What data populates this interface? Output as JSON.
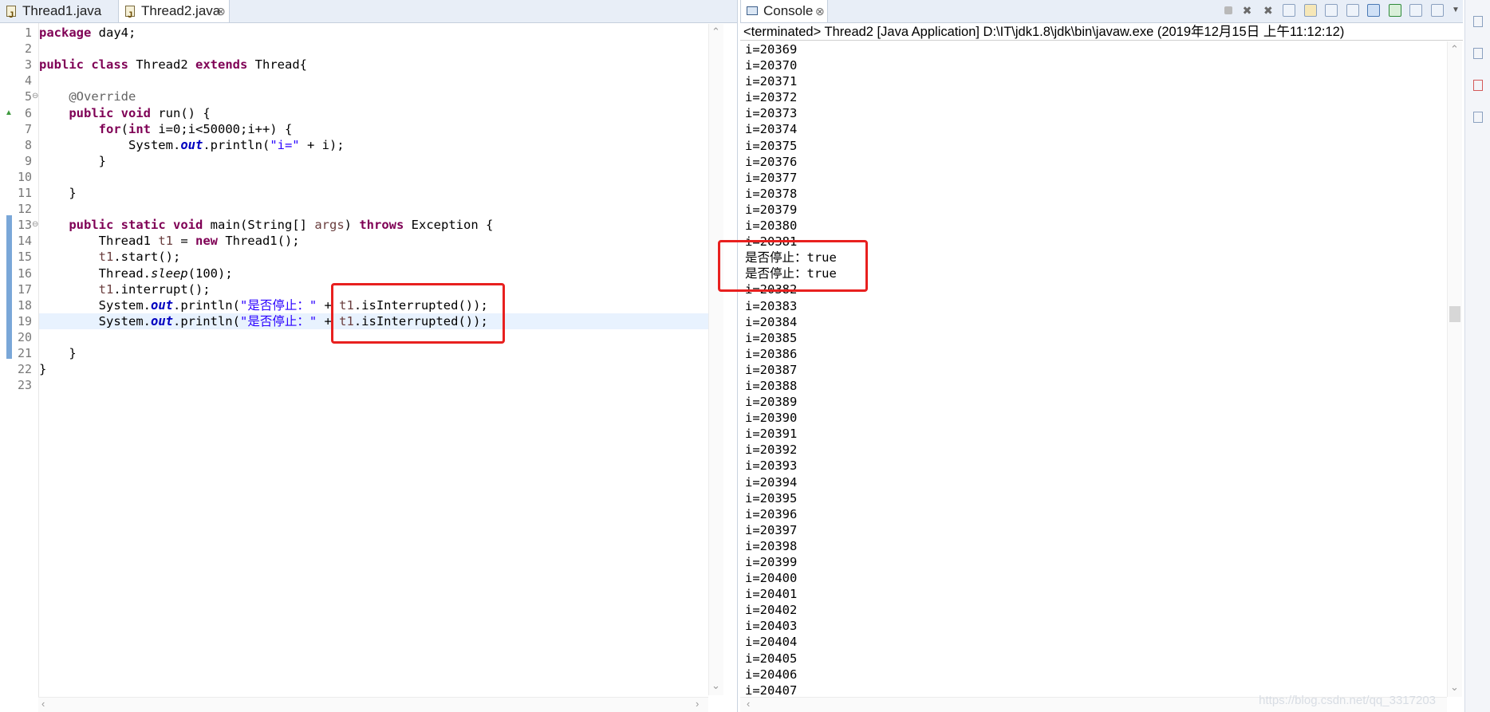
{
  "editor": {
    "tabs": [
      {
        "label": "Thread1.java",
        "active": false
      },
      {
        "label": "Thread2.java",
        "active": true,
        "close": "⊗"
      }
    ],
    "lines": [
      {
        "n": "1",
        "tokens": [
          {
            "t": "package",
            "c": "kw"
          },
          {
            "t": " day4;"
          }
        ]
      },
      {
        "n": "2",
        "tokens": []
      },
      {
        "n": "3",
        "tokens": [
          {
            "t": "public",
            "c": "kw"
          },
          {
            "t": " "
          },
          {
            "t": "class",
            "c": "kw"
          },
          {
            "t": " Thread2 "
          },
          {
            "t": "extends",
            "c": "kw"
          },
          {
            "t": " Thread{"
          }
        ]
      },
      {
        "n": "4",
        "tokens": []
      },
      {
        "n": "5",
        "fold": "⊖",
        "tokens": [
          {
            "t": "    "
          },
          {
            "t": "@Override",
            "c": "ann"
          }
        ]
      },
      {
        "n": "6",
        "marker": "▲",
        "tokens": [
          {
            "t": "    "
          },
          {
            "t": "public",
            "c": "kw"
          },
          {
            "t": " "
          },
          {
            "t": "void",
            "c": "kw"
          },
          {
            "t": " run() {"
          }
        ]
      },
      {
        "n": "7",
        "tokens": [
          {
            "t": "        "
          },
          {
            "t": "for",
            "c": "kw"
          },
          {
            "t": "("
          },
          {
            "t": "int",
            "c": "kw"
          },
          {
            "t": " i=0;i<50000;i++) {"
          }
        ]
      },
      {
        "n": "8",
        "tokens": [
          {
            "t": "            System."
          },
          {
            "t": "out",
            "c": "fld"
          },
          {
            "t": ".println("
          },
          {
            "t": "\"i=\"",
            "c": "str"
          },
          {
            "t": " + i);"
          }
        ]
      },
      {
        "n": "9",
        "tokens": [
          {
            "t": "        }"
          }
        ]
      },
      {
        "n": "10",
        "tokens": []
      },
      {
        "n": "11",
        "tokens": [
          {
            "t": "    }"
          }
        ]
      },
      {
        "n": "12",
        "tokens": []
      },
      {
        "n": "13",
        "fold": "⊖",
        "tokens": [
          {
            "t": "    "
          },
          {
            "t": "public",
            "c": "kw"
          },
          {
            "t": " "
          },
          {
            "t": "static",
            "c": "kw"
          },
          {
            "t": " "
          },
          {
            "t": "void",
            "c": "kw"
          },
          {
            "t": " main(String[] "
          },
          {
            "t": "args",
            "c": "var"
          },
          {
            "t": ") "
          },
          {
            "t": "throws",
            "c": "kw"
          },
          {
            "t": " Exception {"
          }
        ]
      },
      {
        "n": "14",
        "tokens": [
          {
            "t": "        Thread1 "
          },
          {
            "t": "t1",
            "c": "var"
          },
          {
            "t": " = "
          },
          {
            "t": "new",
            "c": "kw"
          },
          {
            "t": " Thread1();"
          }
        ]
      },
      {
        "n": "15",
        "tokens": [
          {
            "t": "        "
          },
          {
            "t": "t1",
            "c": "var"
          },
          {
            "t": ".start();"
          }
        ]
      },
      {
        "n": "16",
        "tokens": [
          {
            "t": "        Thread."
          },
          {
            "t": "sleep",
            "c": "sta"
          },
          {
            "t": "(100);"
          }
        ]
      },
      {
        "n": "17",
        "tokens": [
          {
            "t": "        "
          },
          {
            "t": "t1",
            "c": "var"
          },
          {
            "t": ".interrupt();"
          }
        ]
      },
      {
        "n": "18",
        "tokens": [
          {
            "t": "        System."
          },
          {
            "t": "out",
            "c": "fld"
          },
          {
            "t": ".println("
          },
          {
            "t": "\"是否停止：\"",
            "c": "str"
          },
          {
            "t": " + "
          },
          {
            "t": "t1",
            "c": "var"
          },
          {
            "t": ".isInterrupted());"
          }
        ]
      },
      {
        "n": "19",
        "current": true,
        "tokens": [
          {
            "t": "        System."
          },
          {
            "t": "out",
            "c": "fld"
          },
          {
            "t": ".println("
          },
          {
            "t": "\"是否停止：\"",
            "c": "str"
          },
          {
            "t": " + "
          },
          {
            "t": "t1",
            "c": "var"
          },
          {
            "t": ".isInterrupted());"
          }
        ]
      },
      {
        "n": "20",
        "tokens": []
      },
      {
        "n": "21",
        "tokens": [
          {
            "t": "    }"
          }
        ]
      },
      {
        "n": "22",
        "tokens": [
          {
            "t": "}"
          }
        ]
      },
      {
        "n": "23",
        "tokens": []
      }
    ]
  },
  "console": {
    "tab_label": "Console",
    "close": "⊗",
    "status": "<terminated> Thread2 [Java Application] D:\\IT\\jdk1.8\\jdk\\bin\\javaw.exe (2019年12月15日 上午11:12:12)",
    "output": [
      "i=20369",
      "i=20370",
      "i=20371",
      "i=20372",
      "i=20373",
      "i=20374",
      "i=20375",
      "i=20376",
      "i=20377",
      "i=20378",
      "i=20379",
      "i=20380",
      "i=20381",
      "是否停止：true",
      "是否停止：true",
      "i=20382",
      "i=20383",
      "i=20384",
      "i=20385",
      "i=20386",
      "i=20387",
      "i=20388",
      "i=20389",
      "i=20390",
      "i=20391",
      "i=20392",
      "i=20393",
      "i=20394",
      "i=20395",
      "i=20396",
      "i=20397",
      "i=20398",
      "i=20399",
      "i=20400",
      "i=20401",
      "i=20402",
      "i=20403",
      "i=20404",
      "i=20405",
      "i=20406",
      "i=20407"
    ],
    "watermark": "https://blog.csdn.net/qq_3317203"
  },
  "colors": {
    "highlight": "#e8201f",
    "current_line": "#e8f2fe",
    "keyword": "#7f0055",
    "string": "#2a00ff"
  },
  "icons": [
    "java-file-icon",
    "console-icon",
    "terminate-icon",
    "remove-launch-icon",
    "remove-all-icon",
    "scroll-lock-icon",
    "pin-console-icon",
    "display-console-icon",
    "open-console-icon",
    "view-menu-icon"
  ]
}
